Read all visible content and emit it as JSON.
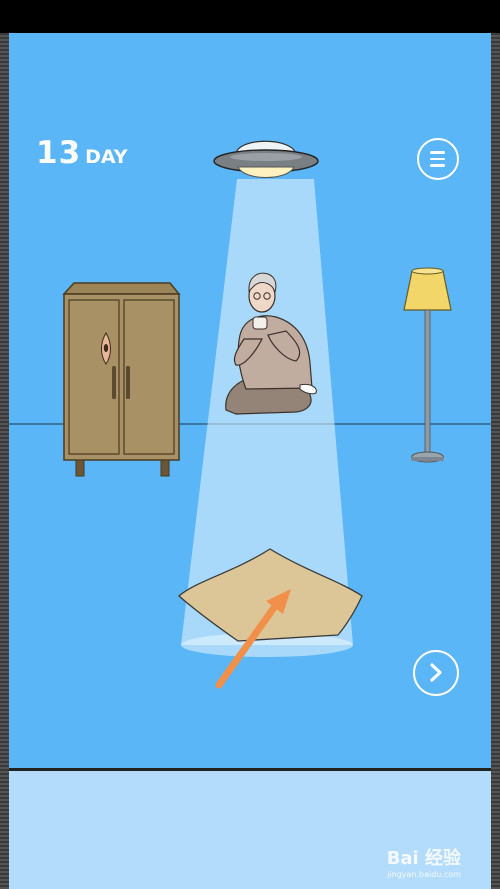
{
  "hud": {
    "day_number": "13",
    "day_label": "DAY"
  },
  "buttons": {
    "menu_icon": "hamburger-menu",
    "next_icon": "chevron-right"
  },
  "scene": {
    "objects": [
      "ufo",
      "tractor-beam",
      "old-man-kneeling",
      "wardrobe",
      "eye-peeking",
      "floor-lamp",
      "floor-cushion",
      "hint-arrow"
    ],
    "colors": {
      "sky": "#5ab6f7",
      "beam": "#e6f5ff",
      "wardrobe": "#a89164",
      "lamp_shade": "#f2d66a",
      "cushion": "#dcc698",
      "arrow": "#f0904a",
      "bottom_panel": "#b3dcfc"
    }
  },
  "watermark": {
    "brand": "Bai 经验",
    "url": "jingyan.baidu.com"
  }
}
